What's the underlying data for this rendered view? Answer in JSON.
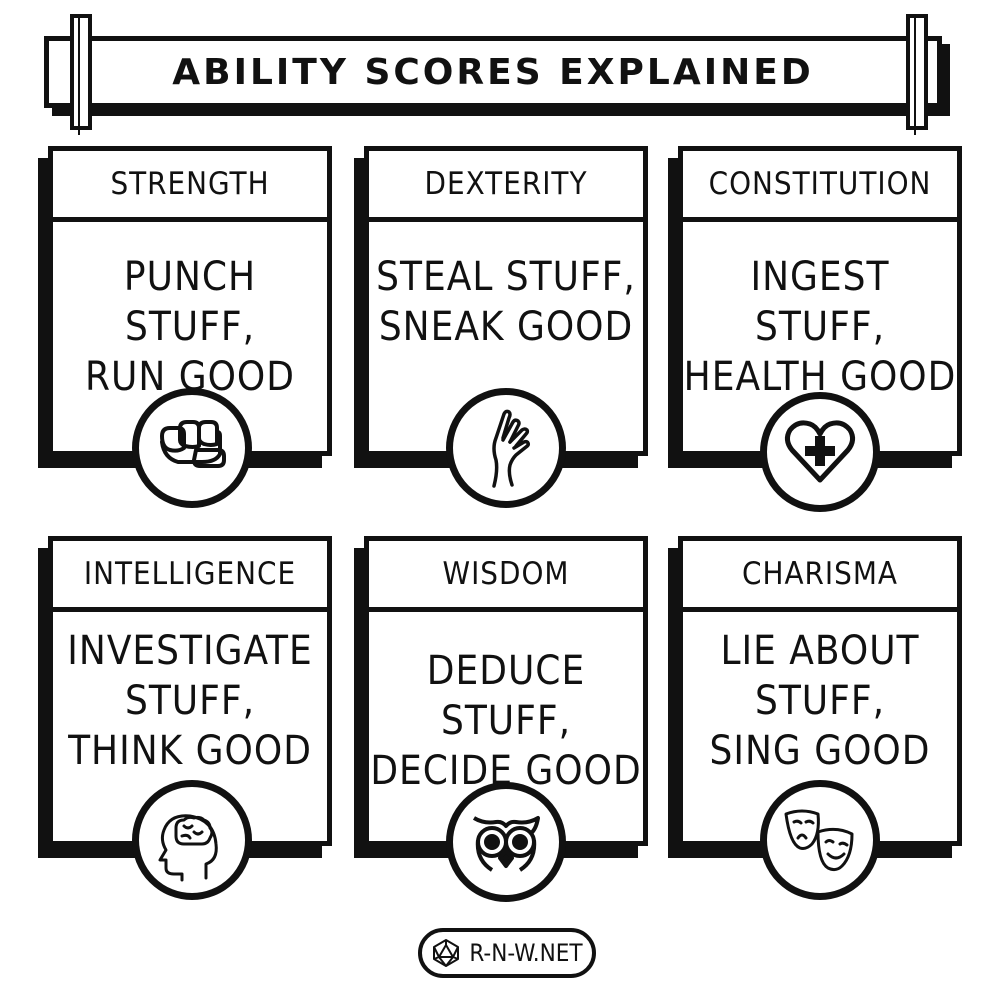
{
  "title": "ABILITY SCORES EXPLAINED",
  "cards": [
    {
      "title": "STRENGTH",
      "lines": [
        "PUNCH STUFF,",
        "RUN GOOD"
      ],
      "icon": "fist-icon"
    },
    {
      "title": "DEXTERITY",
      "lines": [
        "STEAL STUFF,",
        "SNEAK GOOD"
      ],
      "icon": "hand-icon"
    },
    {
      "title": "CONSTITUTION",
      "lines": [
        "INGEST STUFF,",
        "HEALTH GOOD"
      ],
      "icon": "heart-plus-icon"
    },
    {
      "title": "INTELLIGENCE",
      "lines": [
        "INVESTIGATE",
        "STUFF,",
        "THINK GOOD"
      ],
      "icon": "brain-head-icon"
    },
    {
      "title": "WISDOM",
      "lines": [
        "DEDUCE STUFF,",
        "DECIDE GOOD"
      ],
      "icon": "owl-icon"
    },
    {
      "title": "CHARISMA",
      "lines": [
        "LIE ABOUT",
        "STUFF,",
        "SING GOOD"
      ],
      "icon": "theater-masks-icon"
    }
  ],
  "footer": {
    "text": "R-N-W.NET",
    "icon": "d20-icon"
  }
}
